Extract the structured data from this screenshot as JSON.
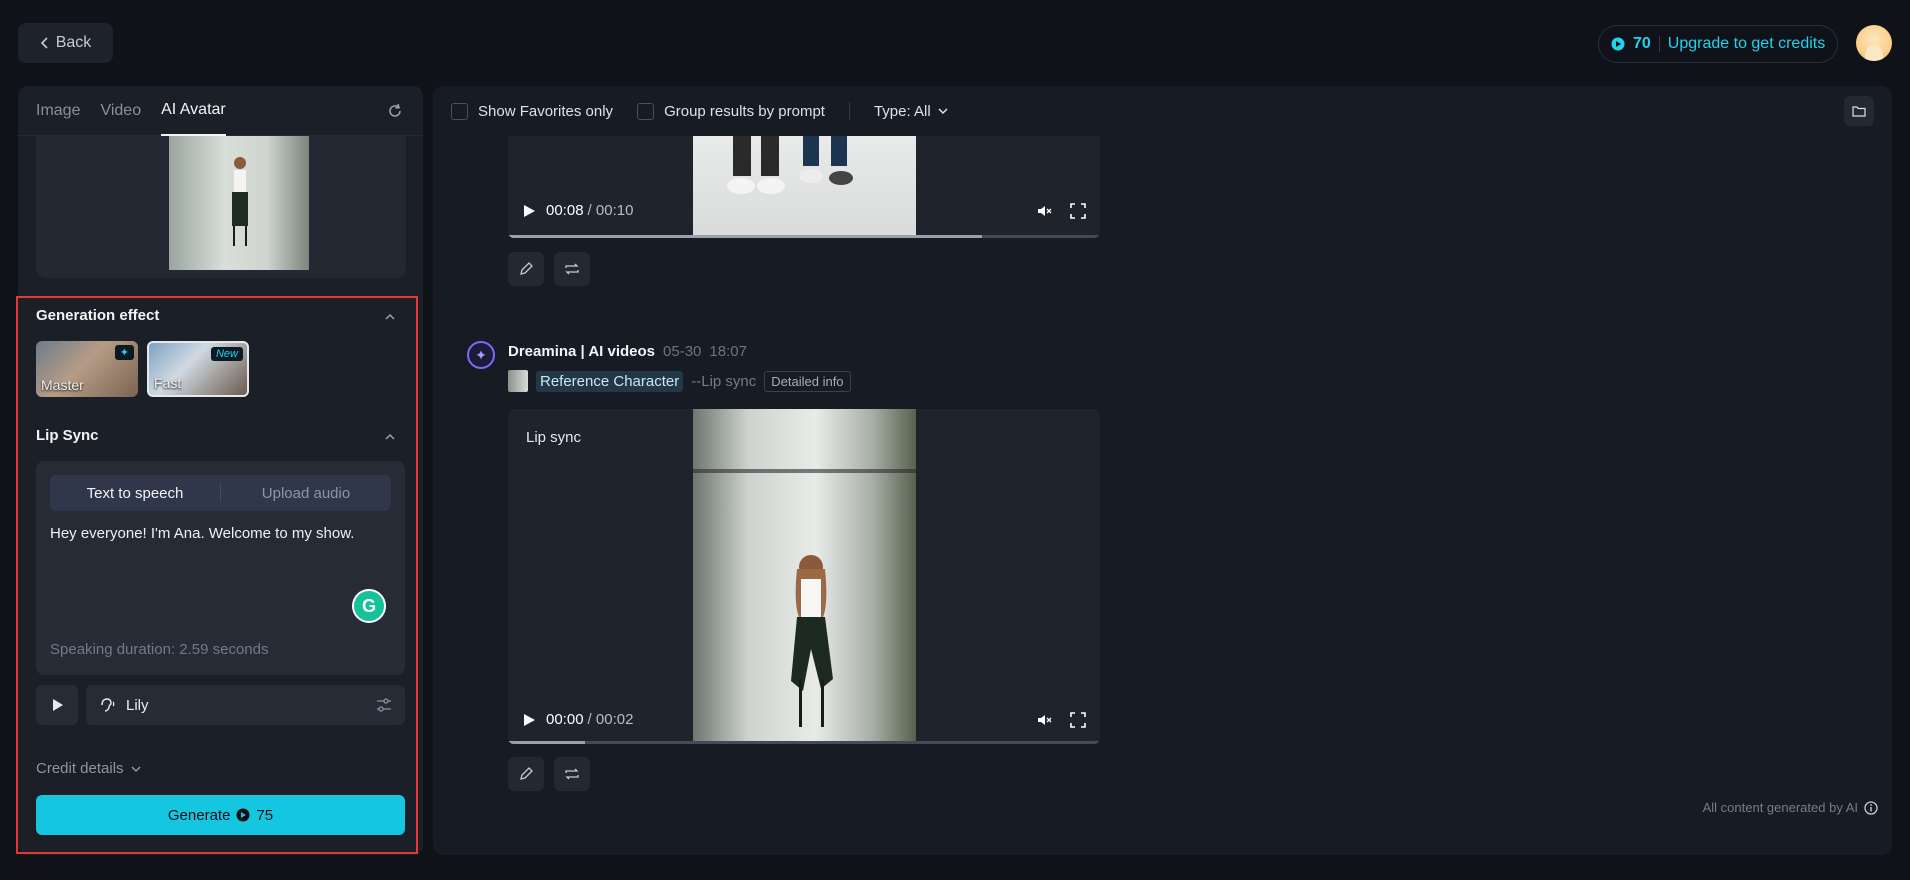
{
  "header": {
    "back_label": "Back",
    "credits": "70",
    "upgrade_label": "Upgrade to get credits"
  },
  "left": {
    "tabs": [
      {
        "label": "Image"
      },
      {
        "label": "Video"
      },
      {
        "label": "AI Avatar"
      }
    ],
    "generation_effect": {
      "title": "Generation effect",
      "options": [
        {
          "label": "Master",
          "badge": "✦"
        },
        {
          "label": "Fast",
          "badge": "New"
        }
      ]
    },
    "lip_sync": {
      "title": "Lip Sync",
      "modes": [
        "Text to speech",
        "Upload audio"
      ],
      "text": "Hey everyone! I'm Ana. Welcome to my show.",
      "duration": "Speaking duration: 2.59 seconds",
      "voice": "Lily"
    },
    "credit_details_label": "Credit details",
    "generate_label": "Generate",
    "generate_cost": "75"
  },
  "toolbar": {
    "favorites_label": "Show Favorites only",
    "group_label": "Group results by prompt",
    "type_label": "Type: All"
  },
  "videos": [
    {
      "current": "00:08",
      "total": "/ 00:10",
      "progress": 0.8
    },
    {
      "overlay_label": "Lip sync",
      "current": "00:00",
      "total": "/ 00:02",
      "progress": 0.13
    }
  ],
  "entry": {
    "title": "Dreamina | AI videos",
    "date": "05-30",
    "time": "18:07",
    "reference": "Reference Character",
    "mode": "--Lip sync",
    "detail": "Detailed info"
  },
  "footer_note": "All content generated by AI"
}
